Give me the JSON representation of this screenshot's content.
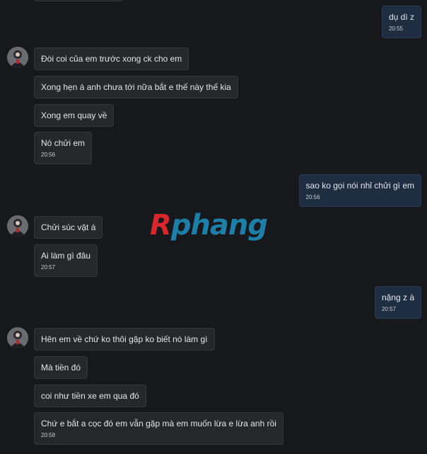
{
  "messages": [
    {
      "text": "dụ dì z",
      "time": "20:55"
    },
    {
      "text": "Đòi coi của em trước xong ck cho em"
    },
    {
      "text": "Xong hẹn á anh chưa tới nữa bắt e thế này thế kia"
    },
    {
      "text": "Xong em quay về"
    },
    {
      "text": "Nó chửi em",
      "time": "20:56"
    },
    {
      "text": "sao ko gọi nói nhỉ chửi gì em",
      "time": "20:56"
    },
    {
      "text": "Chửi súc vật á"
    },
    {
      "text": "Ai làm gì đâu",
      "time": "20:57"
    },
    {
      "text": "nặng z à",
      "time": "20:57"
    },
    {
      "text": "Hên em về chứ ko thôi gặp ko biết nó làm gì"
    },
    {
      "text": "Mà tiền đó"
    },
    {
      "text": "coi như tiền xe em qua đó"
    },
    {
      "text": "Chứ e bắt a cọc đó em vẫn gặp mà em muốn lừa e lừa anh rồi",
      "time": "20:58"
    }
  ],
  "watermark": {
    "first": "R",
    "rest": "phang"
  },
  "colors": {
    "background": "#17181c",
    "incoming_bubble": "#25272b",
    "outgoing_bubble": "#1f2d43",
    "watermark_red": "#d7262c",
    "watermark_blue": "#1d7fa8"
  }
}
